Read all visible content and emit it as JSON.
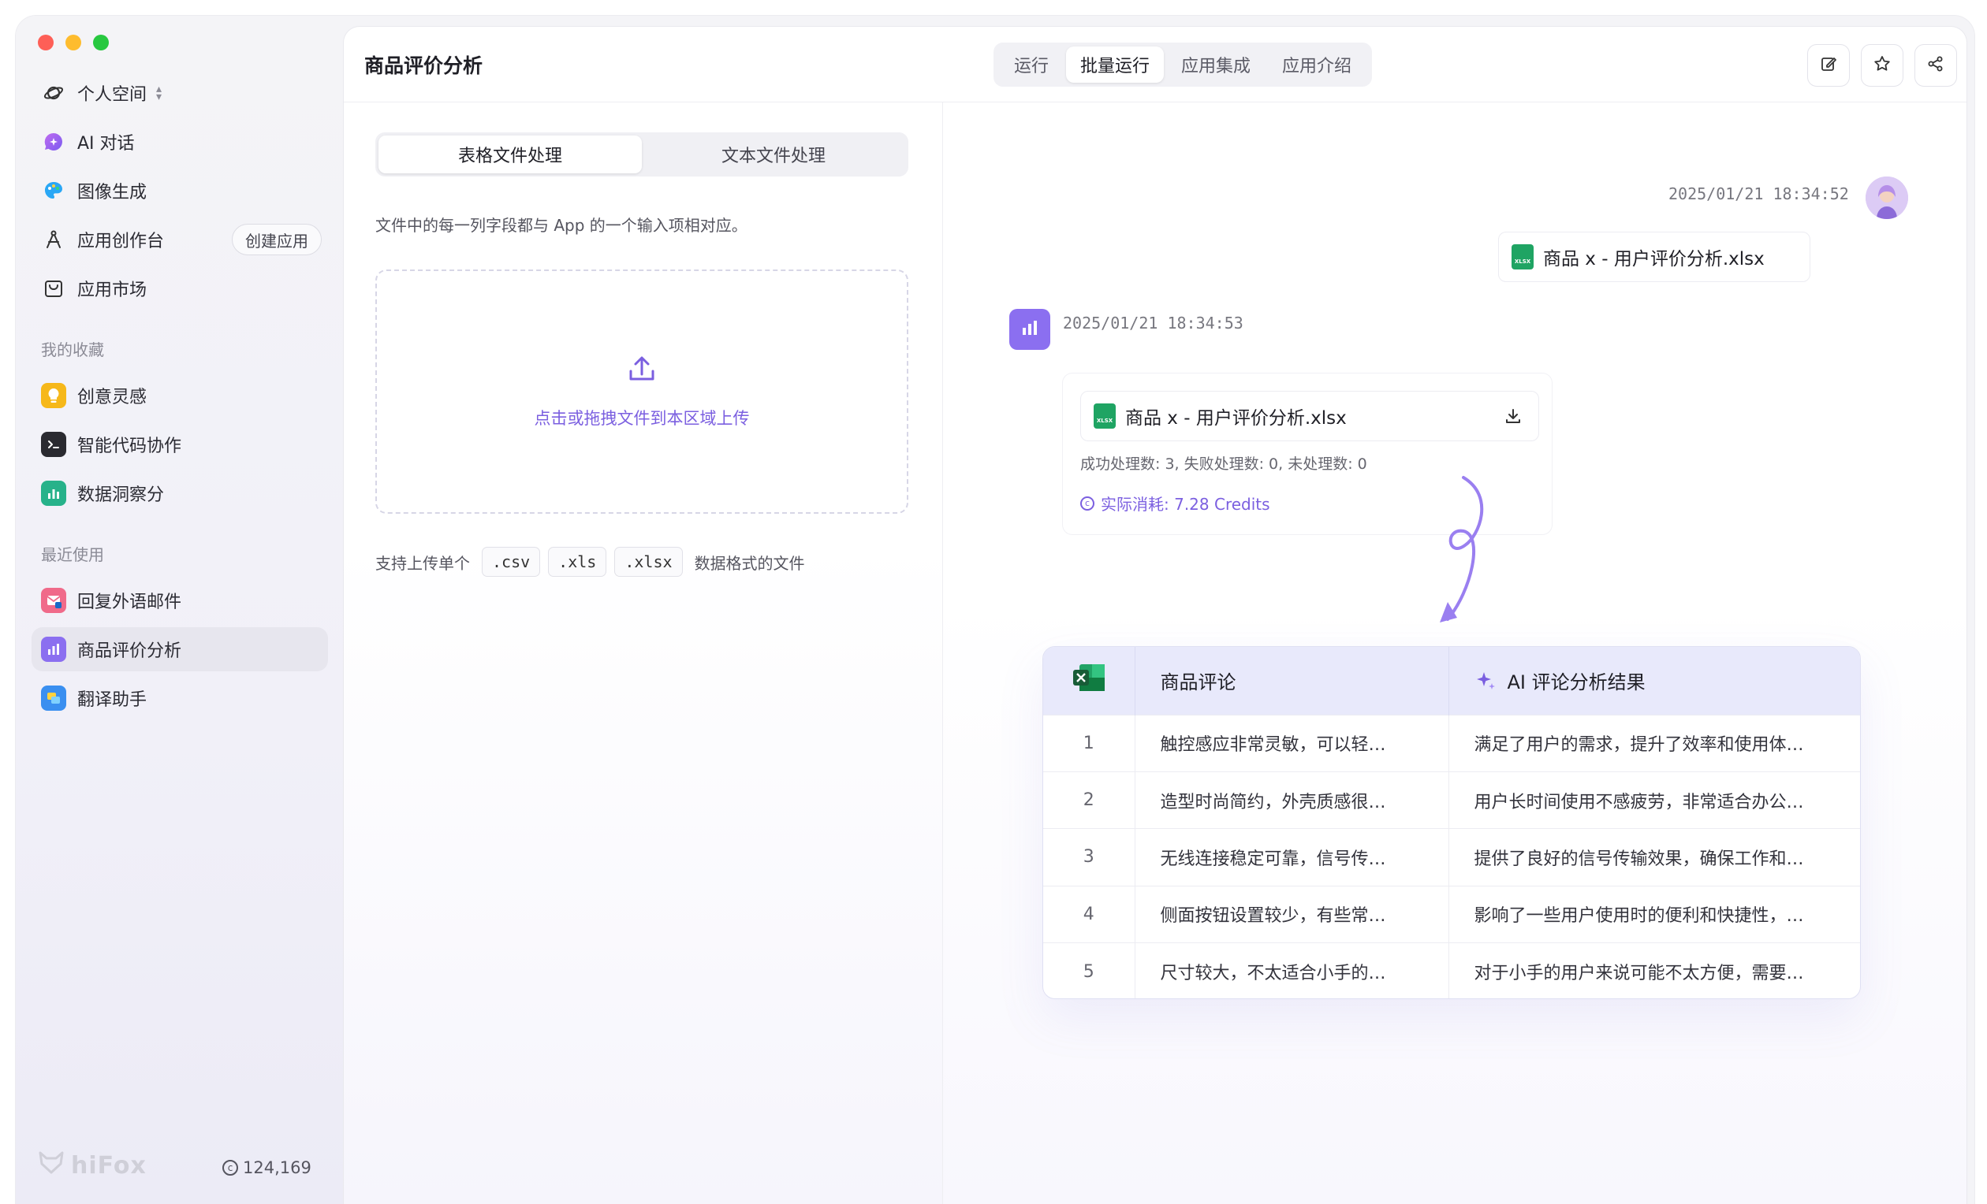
{
  "sidebar": {
    "workspace": "个人空间",
    "items": [
      {
        "label": "AI 对话",
        "icon": "chat-bubble-icon"
      },
      {
        "label": "图像生成",
        "icon": "palette-icon"
      },
      {
        "label": "应用创作台",
        "icon": "compass-icon",
        "action": "创建应用"
      },
      {
        "label": "应用市场",
        "icon": "store-icon"
      }
    ],
    "favorites_label": "我的收藏",
    "favorites": [
      {
        "label": "创意灵感",
        "icon": "lightbulb-icon"
      },
      {
        "label": "智能代码协作",
        "icon": "terminal-icon"
      },
      {
        "label": "数据洞察分",
        "icon": "chart-icon"
      }
    ],
    "recent_label": "最近使用",
    "recent": [
      {
        "label": "回复外语邮件",
        "icon": "mail-icon"
      },
      {
        "label": "商品评价分析",
        "icon": "bar-chart-icon"
      },
      {
        "label": "翻译助手",
        "icon": "translate-icon"
      }
    ],
    "brand": "hiFox",
    "credits": "124,169"
  },
  "header": {
    "title": "商品评价分析",
    "tabs": [
      "运行",
      "批量运行",
      "应用集成",
      "应用介绍"
    ],
    "active_tab": "批量运行"
  },
  "left": {
    "seg": [
      "表格文件处理",
      "文本文件处理"
    ],
    "hint": "文件中的每一列字段都与 App 的一个输入项相对应。",
    "upload_text": "点击或拖拽文件到本区域上传",
    "support_prefix": "支持上传单个",
    "formats": [
      ".csv",
      ".xls",
      ".xlsx"
    ],
    "support_suffix": "数据格式的文件"
  },
  "chat": {
    "user_time": "2025/01/21 18:34:52",
    "user_file": "商品 x - 用户评价分析.xlsx",
    "bot_time": "2025/01/21 18:34:53",
    "bot_file": "商品 x - 用户评价分析.xlsx",
    "stats": "成功处理数: 3, 失败处理数: 0, 未处理数: 0",
    "cost": "实际消耗: 7.28 Credits"
  },
  "table": {
    "col1": "商品评论",
    "col2": "AI 评论分析结果",
    "rows": [
      {
        "idx": "1",
        "review": "触控感应非常灵敏，可以轻…",
        "result": "满足了用户的需求，提升了效率和使用体…"
      },
      {
        "idx": "2",
        "review": "造型时尚简约，外壳质感很…",
        "result": "用户长时间使用不感疲劳，非常适合办公…"
      },
      {
        "idx": "3",
        "review": "无线连接稳定可靠，信号传…",
        "result": "提供了良好的信号传输效果，确保工作和…"
      },
      {
        "idx": "4",
        "review": "侧面按钮设置较少，有些常…",
        "result": "影响了一些用户使用时的便利和快捷性，…"
      },
      {
        "idx": "5",
        "review": "尺寸较大，不太适合小手的…",
        "result": "对于小手的用户来说可能不太方便，需要…"
      }
    ]
  },
  "colors": {
    "accent": "#7b5fe0",
    "excel_green": "#1fa463",
    "table_header": "#e8e9fb"
  }
}
